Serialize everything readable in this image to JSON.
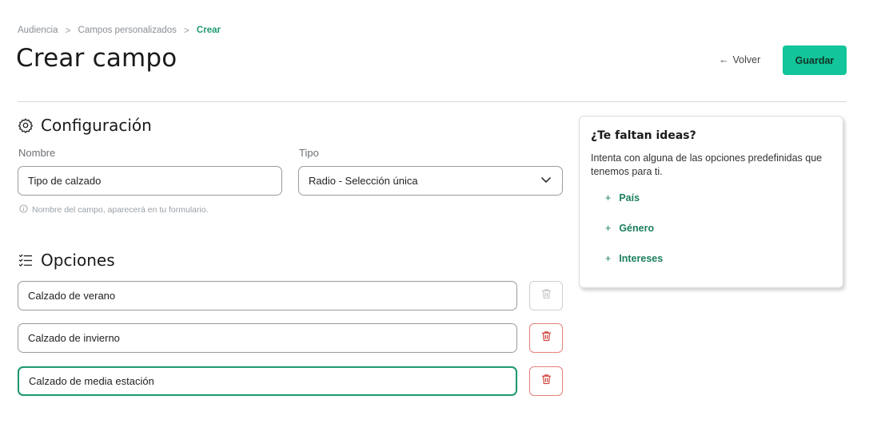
{
  "breadcrumb": {
    "items": [
      "Audiencia",
      "Campos personalizados"
    ],
    "current": "Crear",
    "separator": ">"
  },
  "header": {
    "title": "Crear campo",
    "back_label": "Volver",
    "back_arrow": "←",
    "save_label": "Guardar"
  },
  "config": {
    "title": "Configuración",
    "name_label": "Nombre",
    "name_value": "Tipo de calzado",
    "type_label": "Tipo",
    "type_value": "Radio - Selección única",
    "hint": "Nombre del campo, aparecerá en tu formulario."
  },
  "options": {
    "title": "Opciones",
    "items": [
      {
        "value": "Calzado de verano",
        "deletable": false
      },
      {
        "value": "Calzado de invierno",
        "deletable": true
      },
      {
        "value": "Calzado de media estación",
        "deletable": true,
        "focused": true
      }
    ]
  },
  "ideas": {
    "title": "¿Te faltan ideas?",
    "text": "Intenta con alguna de las opciones predefinidas que tenemos para ti.",
    "items": [
      "País",
      "Género",
      "Intereses"
    ],
    "plus": "+"
  },
  "colors": {
    "accent": "#12c59a",
    "link": "#1b7f5c",
    "danger_border": "#e5807a",
    "danger_icon": "#d0453d",
    "focus_border": "#1f9a6e"
  },
  "icons": {
    "config": "gear-icon",
    "options": "checklist-icon",
    "select": "chevron-down-icon",
    "hint": "info-icon",
    "delete": "trash-icon"
  }
}
